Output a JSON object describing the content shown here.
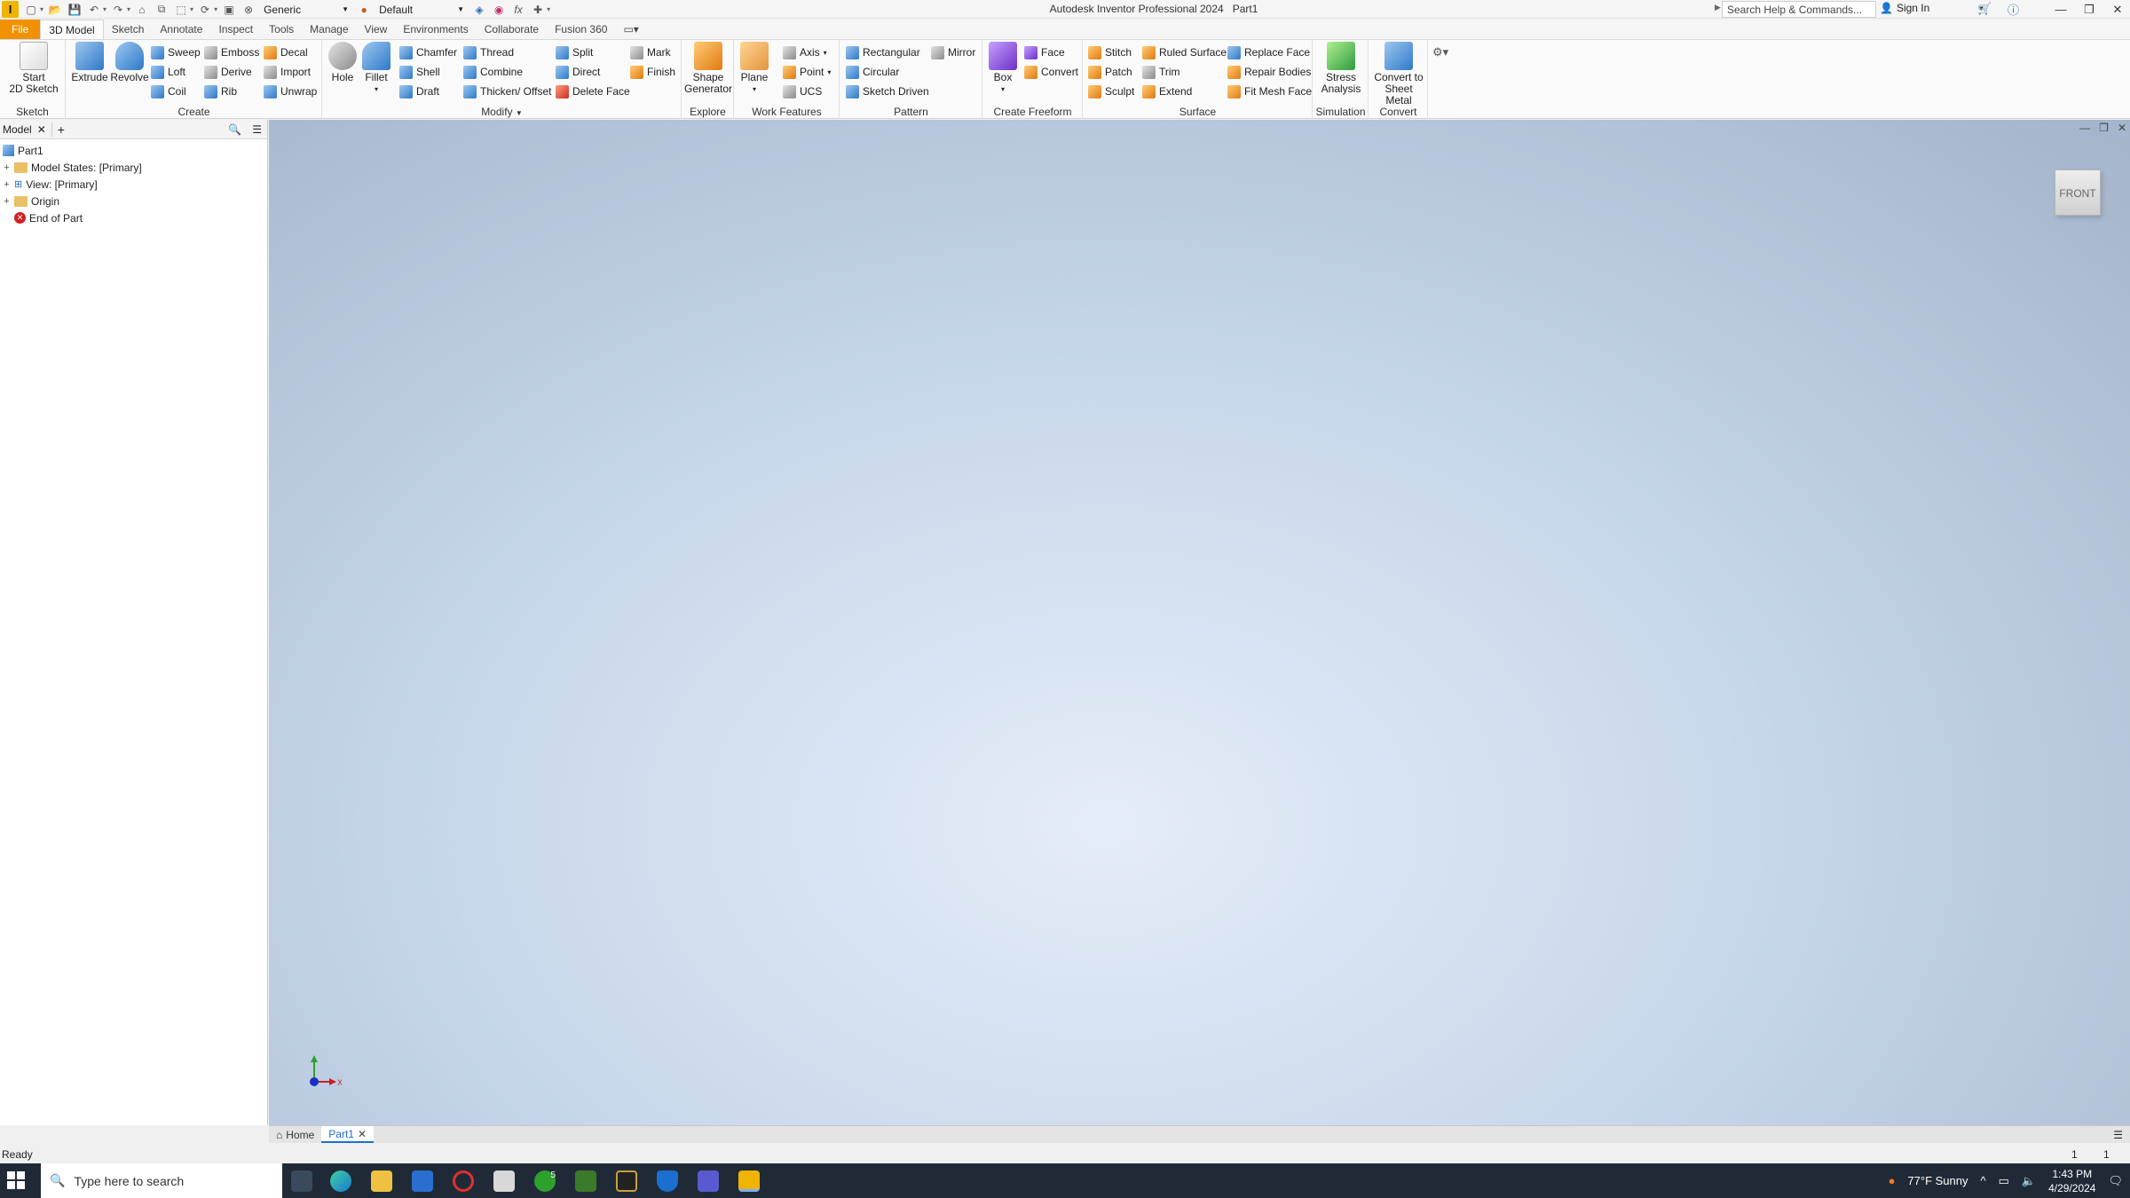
{
  "app": {
    "logo": "I",
    "title": "Autodesk Inventor Professional 2024",
    "document": "Part1",
    "material": "Generic",
    "appearance": "Default",
    "search_placeholder": "Search Help & Commands...",
    "sign_in": "Sign In"
  },
  "tabs": [
    "File",
    "3D Model",
    "Sketch",
    "Annotate",
    "Inspect",
    "Tools",
    "Manage",
    "View",
    "Environments",
    "Collaborate",
    "Fusion 360"
  ],
  "ribbon": {
    "sketch": {
      "title": "Sketch",
      "start": "Start",
      "start2": "2D Sketch"
    },
    "create": {
      "title": "Create",
      "extrude": "Extrude",
      "revolve": "Revolve",
      "sweep": "Sweep",
      "loft": "Loft",
      "coil": "Coil",
      "emboss": "Emboss",
      "derive": "Derive",
      "rib": "Rib",
      "decal": "Decal",
      "import": "Import",
      "unwrap": "Unwrap"
    },
    "modify": {
      "title": "Modify",
      "hole": "Hole",
      "fillet": "Fillet",
      "chamfer": "Chamfer",
      "shell": "Shell",
      "draft": "Draft",
      "thread": "Thread",
      "combine": "Combine",
      "thicken": "Thicken/ Offset",
      "split": "Split",
      "direct": "Direct",
      "delete_face": "Delete Face",
      "mark": "Mark",
      "finish": "Finish"
    },
    "explore": {
      "title": "Explore",
      "shape1": "Shape",
      "shape2": "Generator"
    },
    "work": {
      "title": "Work Features",
      "plane": "Plane",
      "axis": "Axis",
      "point": "Point",
      "ucs": "UCS"
    },
    "pattern": {
      "title": "Pattern",
      "rect": "Rectangular",
      "circ": "Circular",
      "sketch_driven": "Sketch Driven",
      "mirror": "Mirror"
    },
    "freeform": {
      "title": "Create Freeform",
      "box": "Box",
      "face": "Face",
      "convert": "Convert"
    },
    "surface": {
      "title": "Surface",
      "stitch": "Stitch",
      "patch": "Patch",
      "sculpt": "Sculpt",
      "ruled": "Ruled Surface",
      "trim": "Trim",
      "extend": "Extend",
      "replace": "Replace Face",
      "repair": "Repair Bodies",
      "fitmesh": "Fit Mesh Face"
    },
    "simulation": {
      "title": "Simulation",
      "stress1": "Stress",
      "stress2": "Analysis"
    },
    "convert": {
      "title": "Convert",
      "conv1": "Convert to",
      "conv2": "Sheet Metal"
    }
  },
  "browser": {
    "tab": "Model",
    "items": [
      "Part1",
      "Model States: [Primary]",
      "View: [Primary]",
      "Origin",
      "End of Part"
    ]
  },
  "viewport": {
    "viewcube": "FRONT",
    "axis_x": "X"
  },
  "doctabs": {
    "home": "Home",
    "part": "Part1"
  },
  "status": {
    "text": "Ready",
    "n1": "1",
    "n2": "1"
  },
  "taskbar": {
    "search": "Type here to search",
    "weather": "77°F  Sunny",
    "time": "1:43 PM",
    "date": "4/29/2024",
    "xbox_badge": "5"
  },
  "colors": {
    "accent": "#f29100",
    "active_tab": "#1d6fd0",
    "taskbar": "#1f2a36"
  }
}
